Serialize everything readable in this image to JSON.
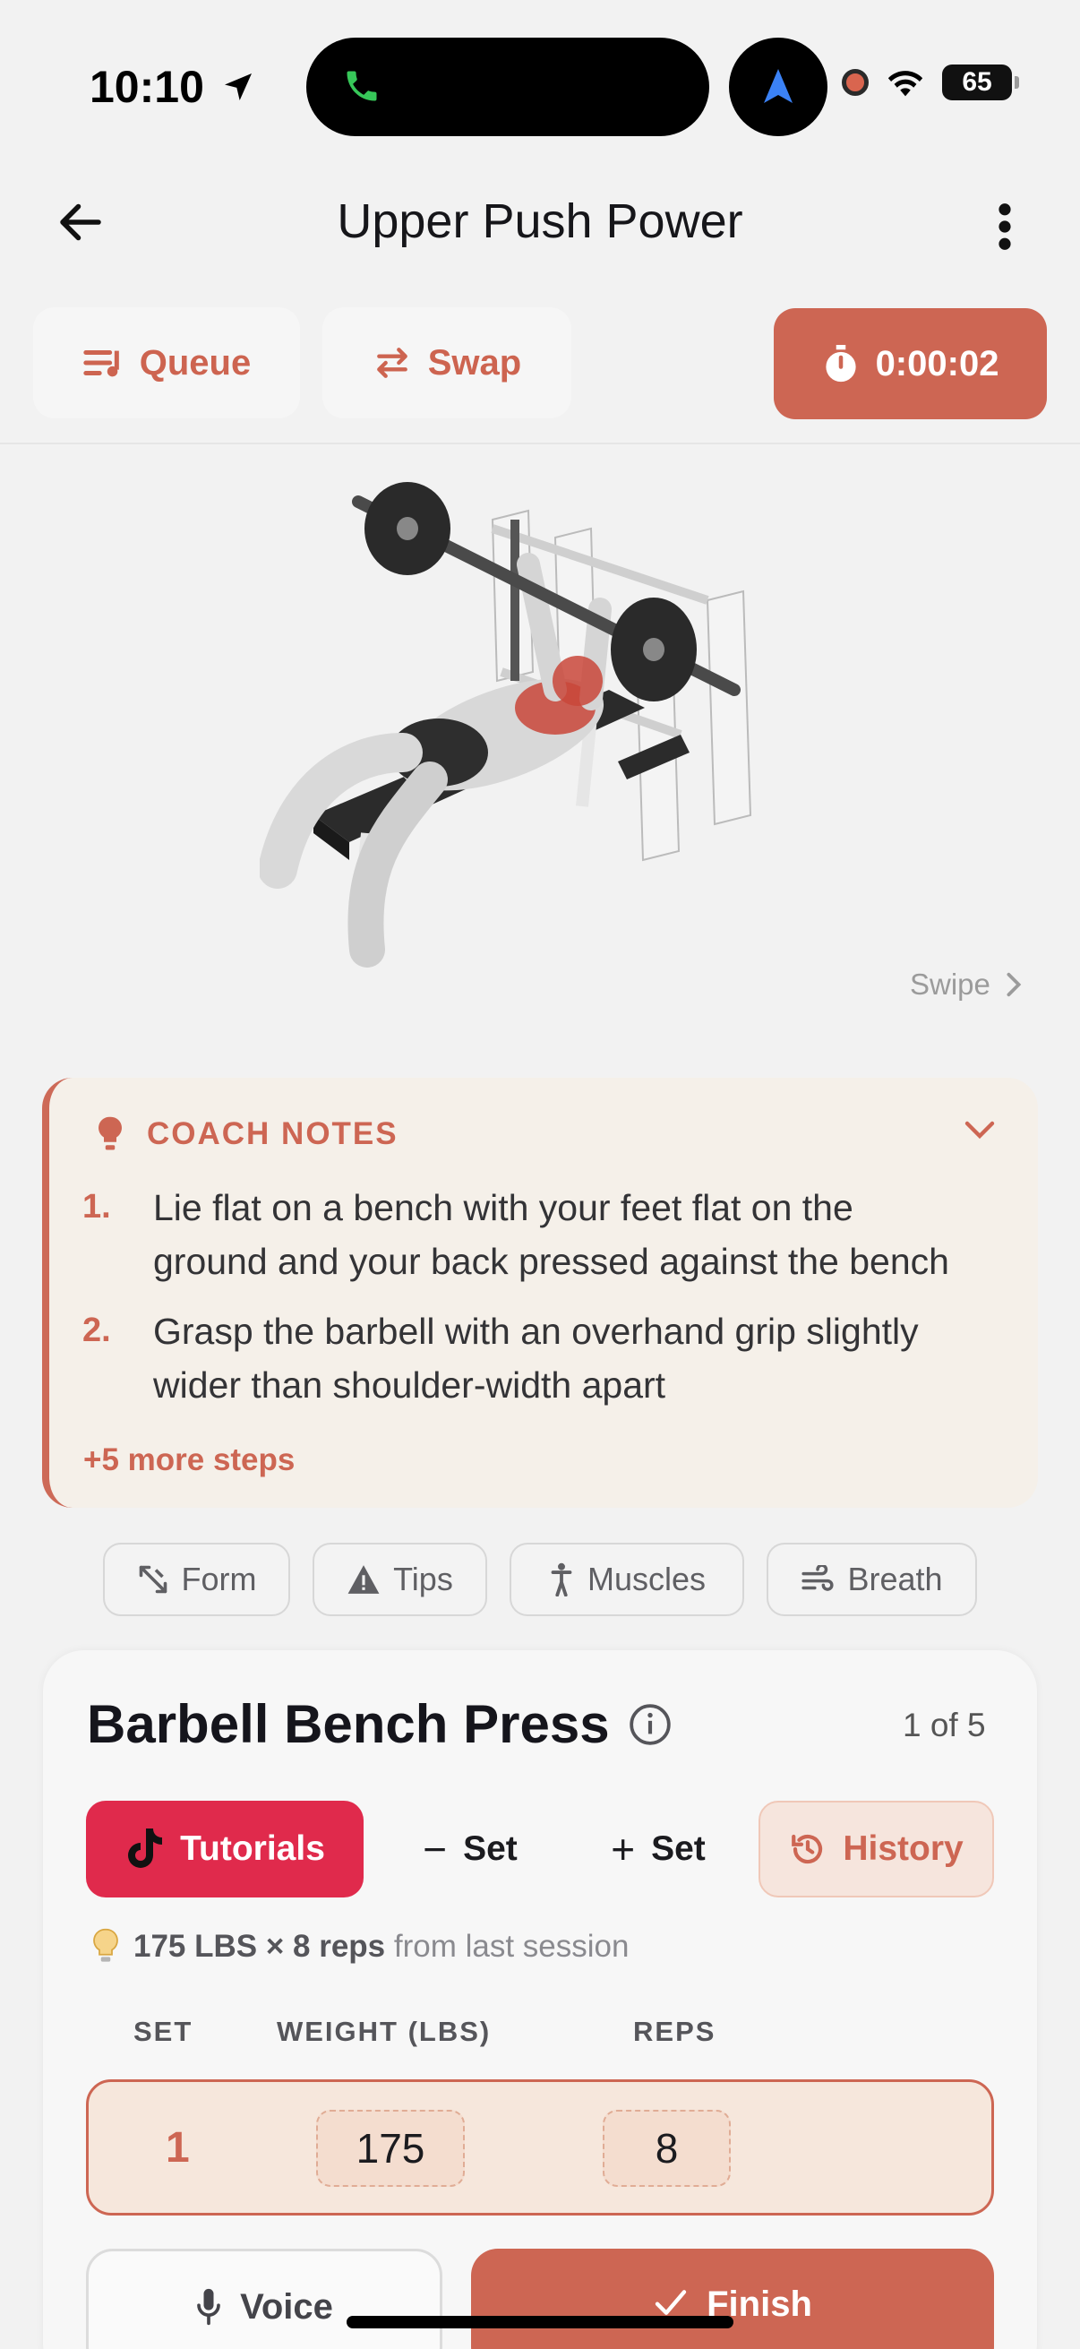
{
  "status": {
    "time": "10:10",
    "battery": "65"
  },
  "header": {
    "title": "Upper Push Power"
  },
  "toolbar": {
    "queue_label": "Queue",
    "swap_label": "Swap",
    "timer": "0:00:02"
  },
  "media": {
    "swipe_label": "Swipe"
  },
  "coach": {
    "heading": "COACH NOTES",
    "steps": [
      {
        "num": "1.",
        "line1": "Lie flat on a bench with your feet flat on the",
        "line2": "ground and your back pressed against the bench"
      },
      {
        "num": "2.",
        "line1": "Grasp the barbell with an overhand grip slightly",
        "line2": "wider than shoulder-width apart"
      }
    ],
    "more": "+5 more steps"
  },
  "chips": {
    "form": "Form",
    "tips": "Tips",
    "muscles": "Muscles",
    "breath": "Breath"
  },
  "exercise": {
    "name": "Barbell Bench Press",
    "position": "1 of 5",
    "tutorials_label": "Tutorials",
    "minus_set_label": "Set",
    "plus_set_label": "Set",
    "history_label": "History",
    "last_session_value": "175 LBS × 8 reps",
    "last_session_suffix": "from last session",
    "columns": {
      "set": "SET",
      "weight": "WEIGHT (LBS)",
      "reps": "REPS"
    },
    "rows": [
      {
        "set": "1",
        "weight": "175",
        "reps": "8"
      }
    ],
    "voice_label": "Voice",
    "finish_label": "Finish"
  },
  "colors": {
    "accent": "#cd6653",
    "tutorials": "#e02a4c",
    "background": "#f2f2f2"
  }
}
